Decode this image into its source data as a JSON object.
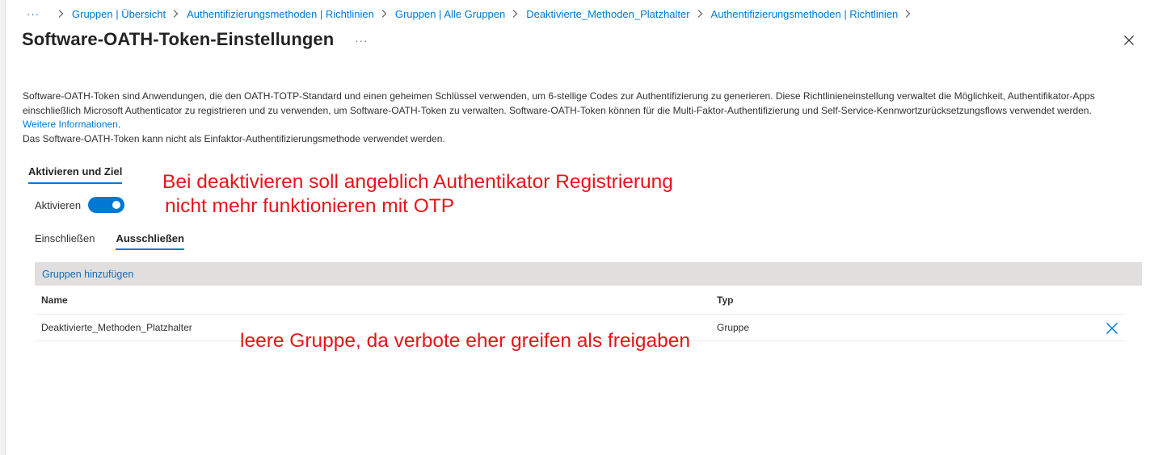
{
  "breadcrumb": {
    "more_glyph": "···",
    "items": [
      {
        "label": "Gruppen | Übersicht"
      },
      {
        "label": "Authentifizierungsmethoden | Richtlinien"
      },
      {
        "label": "Gruppen | Alle Gruppen"
      },
      {
        "label": "Deaktivierte_Methoden_Platzhalter"
      },
      {
        "label": "Authentifizierungsmethoden | Richtlinien"
      }
    ]
  },
  "header": {
    "title": "Software-OATH-Token-Einstellungen",
    "more_glyph": "···"
  },
  "description": {
    "paragraph1": "Software-OATH-Token sind Anwendungen, die den OATH-TOTP-Standard und einen geheimen Schlüssel verwenden, um 6-stellige Codes zur Authentifizierung zu generieren. Diese Richtlinieneinstellung verwaltet die Möglichkeit, Authentifikator-Apps einschließlich Microsoft Authenticator zu registrieren und zu verwenden, um Software-OATH-Token zu verwalten. Software-OATH-Token können für die Multi-Faktor-Authentifizierung und Self-Service-Kennwortzurücksetzungsflows verwendet werden. ",
    "link": "Weitere Informationen",
    "link_suffix": ".",
    "paragraph2": "Das Software-OATH-Token kann nicht als Einfaktor-Authentifizierungsmethode verwendet werden."
  },
  "section_tab": {
    "label": "Aktivieren und Ziel"
  },
  "enable": {
    "label": "Aktivieren",
    "state": "on"
  },
  "sub_tabs": [
    {
      "label": "Einschließen",
      "active": false
    },
    {
      "label": "Ausschließen",
      "active": true
    }
  ],
  "command_bar": {
    "add_groups_label": "Gruppen hinzufügen"
  },
  "table": {
    "columns": [
      "Name",
      "Typ"
    ],
    "rows": [
      {
        "name": "Deaktivierte_Methoden_Platzhalter",
        "type": "Gruppe"
      }
    ]
  },
  "annotations": {
    "note1_line1": "Bei deaktivieren soll angeblich Authentikator Registrierung",
    "note1_line2": "nicht mehr funktionieren mit OTP",
    "note2": "leere Gruppe, da verbote eher greifen als freigaben"
  },
  "colors": {
    "accent": "#0078d4",
    "annotation": "#e8141a",
    "command_bar_bg": "#e1dfdd"
  },
  "icons": {
    "breadcrumb_separator": "chevron-right-icon",
    "close": "close-icon",
    "row_delete": "close-icon"
  }
}
